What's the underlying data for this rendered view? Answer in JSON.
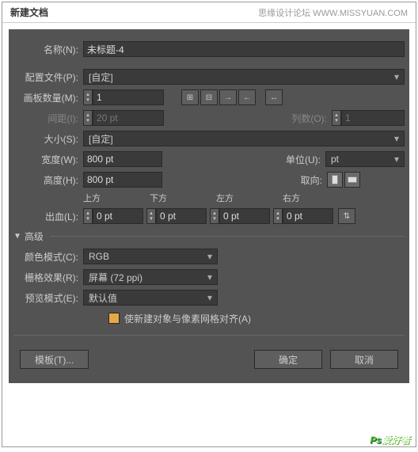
{
  "titlebar": {
    "title": "新建文档",
    "subtitle": "思缘设计论坛  WWW.MISSYUAN.COM"
  },
  "name": {
    "label": "名称(N):",
    "value": "未标题-4"
  },
  "profile": {
    "label": "配置文件(P):",
    "value": "[自定]"
  },
  "artboards": {
    "label": "画板数量(M):",
    "value": "1"
  },
  "spacing": {
    "label": "间距(I):",
    "value": "20 pt"
  },
  "columns": {
    "label": "列数(O):",
    "value": "1"
  },
  "size": {
    "label": "大小(S):",
    "value": "[自定]"
  },
  "width": {
    "label": "宽度(W):",
    "value": "800 pt"
  },
  "units": {
    "label": "单位(U):",
    "value": "pt"
  },
  "height": {
    "label": "高度(H):",
    "value": "800 pt"
  },
  "orient": {
    "label": "取向:"
  },
  "bleed": {
    "label": "出血(L):",
    "top": "上方",
    "bottom": "下方",
    "left": "左方",
    "right": "右方",
    "v": "0 pt"
  },
  "advanced": {
    "label": "高级"
  },
  "colormode": {
    "label": "颜色模式(C):",
    "value": "RGB"
  },
  "raster": {
    "label": "栅格效果(R):",
    "value": "屏幕 (72 ppi)"
  },
  "preview": {
    "label": "预览模式(E):",
    "value": "默认值"
  },
  "align": {
    "label": "使新建对象与像素网格对齐(A)"
  },
  "buttons": {
    "template": "模板(T)...",
    "ok": "确定",
    "cancel": "取消"
  },
  "watermark": {
    "p": "Ps",
    "s": "爱好者"
  }
}
